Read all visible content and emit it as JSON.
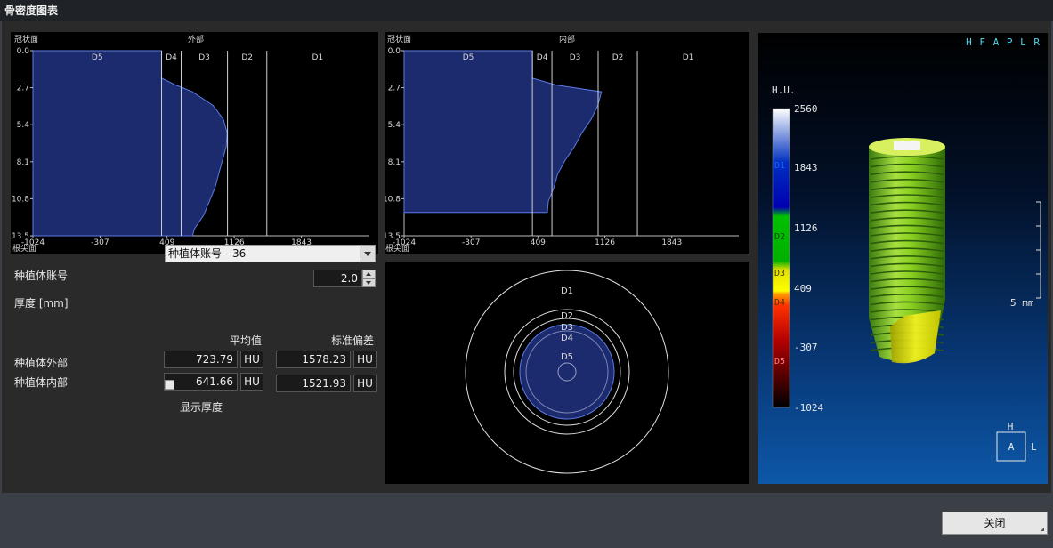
{
  "window": {
    "title": "骨密度图表"
  },
  "charts": {
    "outer": {
      "title": "外部",
      "top_label": "冠状面",
      "bottom_label": "根尖面"
    },
    "inner": {
      "title": "内部",
      "top_label": "冠状面",
      "bottom_label": "根尖面"
    },
    "zones": [
      "D5",
      "D4",
      "D3",
      "D2",
      "D1"
    ],
    "y_ticks": [
      "0.0",
      "2.7",
      "5.4",
      "8.1",
      "10.8",
      "13.5"
    ],
    "x_ticks": [
      "-1024",
      "-307",
      "409",
      "1126",
      "1843"
    ]
  },
  "chart_data": [
    {
      "type": "area",
      "title": "外部",
      "zone_labels": [
        "D5",
        "D4",
        "D3",
        "D2",
        "D1"
      ],
      "zone_boundaries_hu": [
        350,
        559,
        1054,
        1474
      ],
      "x_ticks": [
        -1024,
        -307,
        409,
        1126,
        1843
      ],
      "y_ticks": [
        0.0,
        2.7,
        5.4,
        8.1,
        10.8,
        13.5
      ],
      "xlim": [
        -1024,
        2560
      ],
      "ylim": [
        0,
        13.5
      ],
      "depth_mm": [
        0,
        2.0,
        2.5,
        3.0,
        4.0,
        5.0,
        6.0,
        7.0,
        8.0,
        9.0,
        10.0,
        11.0,
        12.0,
        13.0,
        13.5
      ],
      "hu": [
        350,
        350,
        500,
        680,
        900,
        1010,
        1050,
        1040,
        1000,
        960,
        920,
        860,
        800,
        700,
        680
      ]
    },
    {
      "type": "area",
      "title": "内部",
      "zone_labels": [
        "D5",
        "D4",
        "D3",
        "D2",
        "D1"
      ],
      "zone_boundaries_hu": [
        350,
        559,
        1054,
        1474
      ],
      "x_ticks": [
        -1024,
        -307,
        409,
        1126,
        1843
      ],
      "y_ticks": [
        0.0,
        2.7,
        5.4,
        8.1,
        10.8,
        13.5
      ],
      "xlim": [
        -1024,
        2560
      ],
      "ylim": [
        0,
        13.5
      ],
      "depth_mm": [
        0,
        2.0,
        2.5,
        3.0,
        4.0,
        5.0,
        6.0,
        7.0,
        8.0,
        9.0,
        10.0,
        11.0,
        11.8
      ],
      "hu": [
        350,
        350,
        600,
        1090,
        1050,
        980,
        880,
        800,
        700,
        620,
        580,
        520,
        510
      ]
    }
  ],
  "form": {
    "implant_label": "种植体账号",
    "implant_value": "种植体账号 -  36",
    "thickness_label": "厚度 [mm]",
    "thickness_value": "2.0",
    "mean_header": "平均值",
    "std_header": "标准偏差",
    "outer_label": "种植体外部",
    "inner_label": "种植体内部",
    "outer_mean": "723.79",
    "outer_std": "1578.23",
    "inner_mean": "641.66",
    "inner_std": "1521.93",
    "unit": "HU",
    "show_thickness_label": "显示厚度"
  },
  "cross_section": {
    "labels": [
      "D1",
      "D2",
      "D3",
      "D4",
      "D5"
    ]
  },
  "view3d": {
    "orientation": "H F A P L R",
    "hu_title": "H.U.",
    "scale_values": [
      "2560",
      "1843",
      "1126",
      "409",
      "-307",
      "-1024"
    ],
    "scale_classes": [
      "D1",
      "D2",
      "D3",
      "D4",
      "D5"
    ],
    "scale_bar_label": "5 mm",
    "cube_top": "H",
    "cube_face": "A",
    "cube_right": "L"
  },
  "footer": {
    "close_label": "关闭"
  },
  "colors": {
    "fill": "#1c2a6e",
    "stroke": "#5b7be6",
    "bg_panel": "#000000"
  }
}
